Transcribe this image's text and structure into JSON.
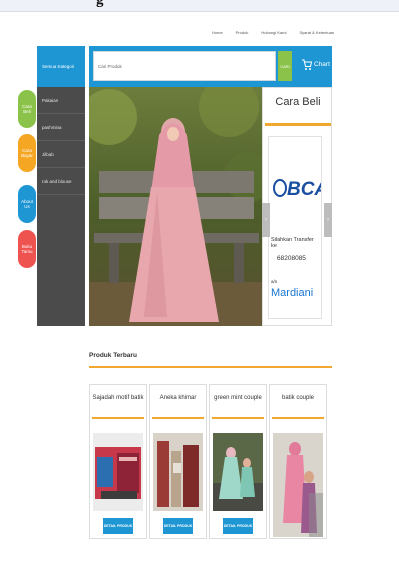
{
  "page_heading": "g",
  "topnav": [
    "Home",
    "Produk",
    "Hubungi Kami",
    "Syarat & Ketentuan"
  ],
  "search": {
    "placeholder": "Cari Produk",
    "button": "CARI"
  },
  "cart_label": "Chart",
  "categories": {
    "header": "Semua Kategori",
    "items": [
      "Pakaian",
      "pashmina",
      "Jilbab",
      "rok and blouse"
    ]
  },
  "side_buttons": [
    {
      "line1": "Cara",
      "line2": "Beli",
      "color": "#8bc34a"
    },
    {
      "line1": "Cara",
      "line2": "Bayar",
      "color": "#f5a623"
    },
    {
      "line1": "About",
      "line2": "Us",
      "color": "#1e96d4"
    },
    {
      "line1": "Buku",
      "line2": "Tamu",
      "color": "#ef5350"
    }
  ],
  "how_to_buy": {
    "title": "Cara Beli",
    "bank_logo_text": "BCA",
    "line1": "Silahkan Transfer ke",
    "account": "68208085",
    "an": "a/n",
    "name": "Mardiani"
  },
  "section_title": "Produk Terbaru",
  "products": [
    {
      "name": "Sajadah motif batik",
      "button": "DETAIL PRODUK"
    },
    {
      "name": "Aneka khimar",
      "button": "DETAIL PRODUK"
    },
    {
      "name": "green mint couple",
      "button": "DETAIL PRODUK"
    },
    {
      "name": "batik couple",
      "button": ""
    }
  ],
  "colors": {
    "accent": "#1e96d4",
    "orange": "#f0a830",
    "green": "#8bc34a",
    "sidebar": "#4b4b4b"
  }
}
